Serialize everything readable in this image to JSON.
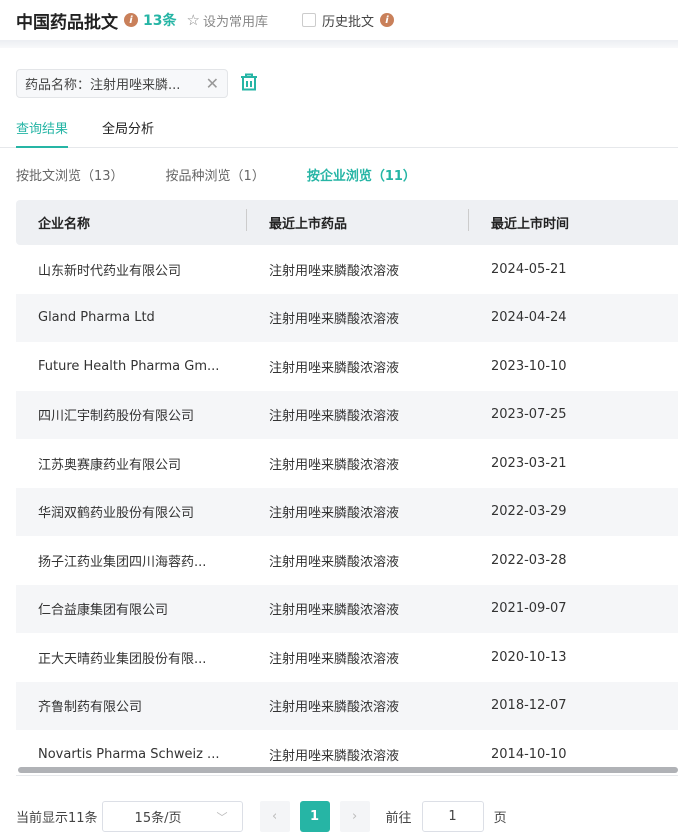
{
  "header": {
    "title": "中国药品批文",
    "count": "13条",
    "favorite": "设为常用库",
    "history": "历史批文"
  },
  "filter": {
    "tag": "药品名称：注射用唑来膦..."
  },
  "tabs": [
    "查询结果",
    "全局分析"
  ],
  "subtabs": [
    "按批文浏览（13）",
    "按品种浏览（1）",
    "按企业浏览（11）"
  ],
  "table": {
    "headers": [
      "企业名称",
      "最近上市药品",
      "最近上市时间"
    ],
    "rows": [
      [
        "山东新时代药业有限公司",
        "注射用唑来膦酸浓溶液",
        "2024-05-21"
      ],
      [
        "Gland Pharma Ltd",
        "注射用唑来膦酸浓溶液",
        "2024-04-24"
      ],
      [
        "Future Health Pharma Gm...",
        "注射用唑来膦酸浓溶液",
        "2023-10-10"
      ],
      [
        "四川汇宇制药股份有限公司",
        "注射用唑来膦酸浓溶液",
        "2023-07-25"
      ],
      [
        "江苏奥赛康药业有限公司",
        "注射用唑来膦酸浓溶液",
        "2023-03-21"
      ],
      [
        "华润双鹤药业股份有限公司",
        "注射用唑来膦酸浓溶液",
        "2022-03-29"
      ],
      [
        "扬子江药业集团四川海蓉药...",
        "注射用唑来膦酸浓溶液",
        "2022-03-28"
      ],
      [
        "仁合益康集团有限公司",
        "注射用唑来膦酸浓溶液",
        "2021-09-07"
      ],
      [
        "正大天晴药业集团股份有限...",
        "注射用唑来膦酸浓溶液",
        "2020-10-13"
      ],
      [
        "齐鲁制药有限公司",
        "注射用唑来膦酸浓溶液",
        "2018-12-07"
      ],
      [
        "Novartis Pharma Schweiz ...",
        "注射用唑来膦酸浓溶液",
        "2014-10-10"
      ]
    ]
  },
  "pager": {
    "summary": "当前显示11条",
    "page_size": "15条/页",
    "current_page": "1",
    "goto_label": "前往",
    "goto_value": "1",
    "page_suffix": "页"
  }
}
